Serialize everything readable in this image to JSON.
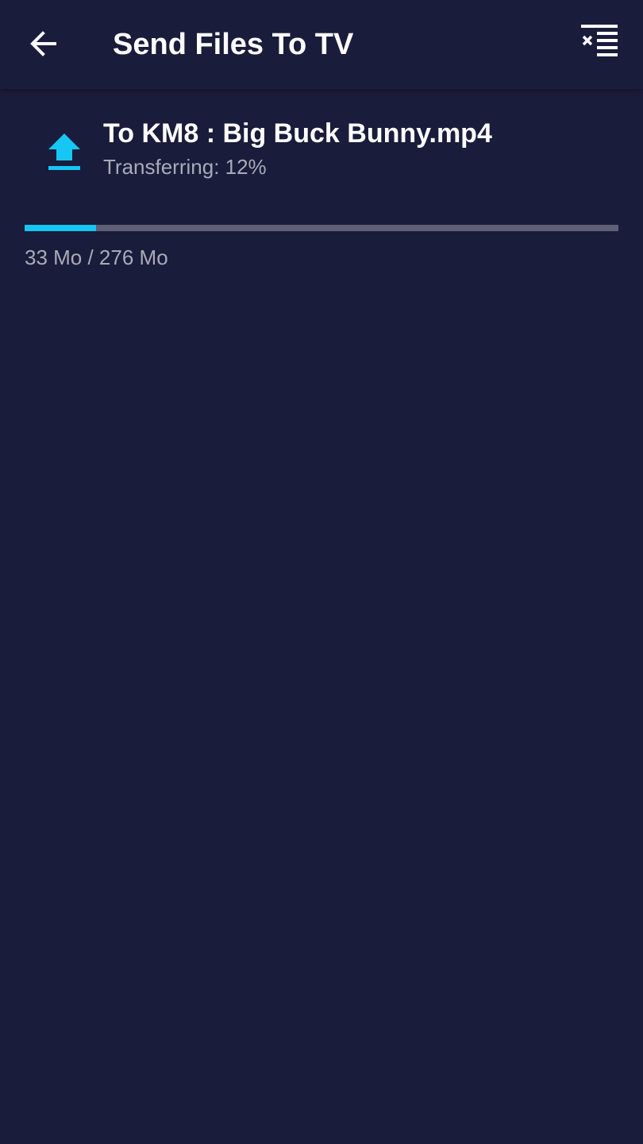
{
  "toolbar": {
    "title": "Send Files To TV",
    "back_icon": "arrow-left-icon",
    "clear_icon": "clear-all-icon"
  },
  "transfer": {
    "icon": "upload-icon",
    "title": "To KM8 : Big Buck Bunny.mp4",
    "status": "Transferring: 12%",
    "progress": 0.12,
    "size": "33 Mo / 276 Mo"
  },
  "colors": {
    "background": "#1a1c3b",
    "accent": "#16c6f3",
    "track": "#5d6077",
    "secondary_text": "#a8abb8"
  }
}
